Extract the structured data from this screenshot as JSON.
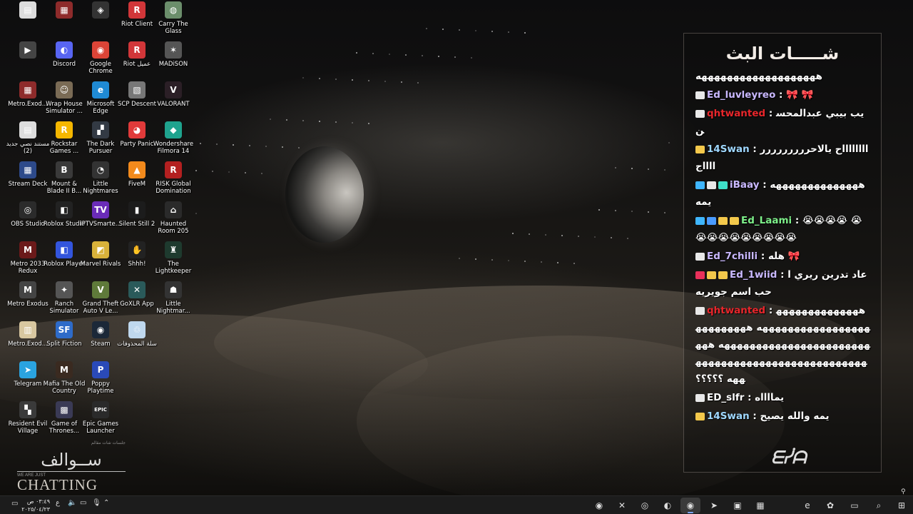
{
  "desktop": {
    "icons": [
      {
        "label": "",
        "color": "#dddddd",
        "glyph": "▤",
        "icon": "text-file-icon"
      },
      {
        "label": "",
        "color": "#8e2b2b",
        "glyph": "▦",
        "icon": "winrar-icon"
      },
      {
        "label": "",
        "color": "#333333",
        "glyph": "◈",
        "icon": "app-icon"
      },
      {
        "label": "Riot Client",
        "color": "#d13639",
        "glyph": "R",
        "icon": "riot-client-icon"
      },
      {
        "label": "Carry The Glass",
        "color": "#6b8e6b",
        "glyph": "◍",
        "icon": "carry-the-glass-icon"
      },
      {
        "label": "",
        "color": "#444444",
        "glyph": "▶",
        "icon": "youtube-icon"
      },
      {
        "label": "Discord",
        "color": "#5865f2",
        "glyph": "◐",
        "icon": "discord-icon"
      },
      {
        "label": "Google Chrome",
        "color": "#db4437",
        "glyph": "◉",
        "icon": "chrome-icon"
      },
      {
        "label": "Riot عميل",
        "color": "#d13639",
        "glyph": "R",
        "icon": "riot-client-icon"
      },
      {
        "label": "MADiSON",
        "color": "#555555",
        "glyph": "✶",
        "icon": "madison-icon"
      },
      {
        "label": "Metro.Exod...",
        "color": "#8e2b2b",
        "glyph": "▦",
        "icon": "winrar-icon"
      },
      {
        "label": "Wrap House Simulator ...",
        "color": "#7a6b55",
        "glyph": "☺",
        "icon": "wrap-house-icon"
      },
      {
        "label": "Microsoft Edge",
        "color": "#1f8ad4",
        "glyph": "e",
        "icon": "edge-icon"
      },
      {
        "label": "SCP Descent",
        "color": "#777777",
        "glyph": "▧",
        "icon": "scp-descent-icon"
      },
      {
        "label": "VALORANT",
        "color": "#2b1f26",
        "glyph": "V",
        "icon": "valorant-icon"
      },
      {
        "label": "مستند نصي جديد (2)",
        "color": "#dddddd",
        "glyph": "▤",
        "icon": "text-file-icon"
      },
      {
        "label": "Rockstar Games ...",
        "color": "#f5b700",
        "glyph": "R",
        "icon": "rockstar-icon"
      },
      {
        "label": "The Dark Pursuer",
        "color": "#333a44",
        "glyph": "▞",
        "icon": "dark-pursuer-icon"
      },
      {
        "label": "Party Panic",
        "color": "#e03a3a",
        "glyph": "◕",
        "icon": "party-panic-icon"
      },
      {
        "label": "Wondershare Filmora 14",
        "color": "#1fa38e",
        "glyph": "◆",
        "icon": "filmora-icon"
      },
      {
        "label": "Stream Deck",
        "color": "#2d4a8a",
        "glyph": "▦",
        "icon": "stream-deck-icon"
      },
      {
        "label": "Mount & Blade II B...",
        "color": "#3a3a3a",
        "glyph": "B",
        "icon": "bannerlord-icon"
      },
      {
        "label": "Little Nightmares",
        "color": "#333333",
        "glyph": "◔",
        "icon": "little-nightmares-icon"
      },
      {
        "label": "FiveM",
        "color": "#f28a1c",
        "glyph": "▲",
        "icon": "fivem-icon"
      },
      {
        "label": "RISK Global Domination",
        "color": "#b32020",
        "glyph": "R",
        "icon": "risk-icon"
      },
      {
        "label": "OBS Studio",
        "color": "#2b2b2b",
        "glyph": "◎",
        "icon": "obs-icon"
      },
      {
        "label": "Roblox Studio",
        "color": "#222222",
        "glyph": "◧",
        "icon": "roblox-studio-icon"
      },
      {
        "label": "IPTVSmarte...",
        "color": "#6a2bb8",
        "glyph": "TV",
        "icon": "iptv-icon"
      },
      {
        "label": "Silent Still 2",
        "color": "#1c1c1c",
        "glyph": "▮",
        "icon": "silent-still-icon"
      },
      {
        "label": "Haunted Room 205",
        "color": "#2a2a2a",
        "glyph": "⌂",
        "icon": "haunted-room-icon"
      },
      {
        "label": "Metro 2033 Redux",
        "color": "#6b1a1a",
        "glyph": "M",
        "icon": "metro-2033-icon"
      },
      {
        "label": "Roblox Player",
        "color": "#3355dd",
        "glyph": "◧",
        "icon": "roblox-icon"
      },
      {
        "label": "Marvel Rivals",
        "color": "#d9b23a",
        "glyph": "◩",
        "icon": "marvel-rivals-icon"
      },
      {
        "label": "Shhh!",
        "color": "#222222",
        "glyph": "✋",
        "icon": "shhh-icon"
      },
      {
        "label": "The Lightkeeper",
        "color": "#1e3a2e",
        "glyph": "♜",
        "icon": "lightkeeper-icon"
      },
      {
        "label": "Metro Exodus",
        "color": "#444444",
        "glyph": "M",
        "icon": "metro-exodus-icon"
      },
      {
        "label": "Ranch Simulator",
        "color": "#555555",
        "glyph": "✦",
        "icon": "ranch-simulator-icon"
      },
      {
        "label": "Grand Theft Auto V Le...",
        "color": "#5f7a3a",
        "glyph": "V",
        "icon": "gta-v-icon"
      },
      {
        "label": "GoXLR App",
        "color": "#2a5a5a",
        "glyph": "✕",
        "icon": "goxlr-icon"
      },
      {
        "label": "Little Nightmar...",
        "color": "#333333",
        "glyph": "☗",
        "icon": "little-nightmares-icon"
      },
      {
        "label": "Metro.Exod...",
        "color": "#d8c7a0",
        "glyph": "▥",
        "icon": "archive-icon"
      },
      {
        "label": "Split Fiction",
        "color": "#2e6bc9",
        "glyph": "SF",
        "icon": "split-fiction-icon"
      },
      {
        "label": "Steam",
        "color": "#1b2838",
        "glyph": "◉",
        "icon": "steam-icon"
      },
      {
        "label": "سلة المحذوفات",
        "color": "#bfd8ee",
        "glyph": "♲",
        "icon": "recycle-bin-icon"
      },
      {
        "label": "",
        "color": "#000000",
        "glyph": "",
        "icon": ""
      },
      {
        "label": "Telegram",
        "color": "#2aa3e0",
        "glyph": "➤",
        "icon": "telegram-icon"
      },
      {
        "label": "Mafia The Old Country",
        "color": "#3a2a20",
        "glyph": "M",
        "icon": "mafia-icon"
      },
      {
        "label": "Poppy Playtime",
        "color": "#2a4ab8",
        "glyph": "P",
        "icon": "poppy-playtime-icon"
      },
      {
        "label": "",
        "color": "#000000",
        "glyph": "",
        "icon": ""
      },
      {
        "label": "",
        "color": "#000000",
        "glyph": "",
        "icon": ""
      },
      {
        "label": "Resident Evil Village",
        "color": "#3a3a3a",
        "glyph": "▚",
        "icon": "resident-evil-icon"
      },
      {
        "label": "Game of Thrones...",
        "color": "#3a3a55",
        "glyph": "▩",
        "icon": "game-of-thrones-icon"
      },
      {
        "label": "Epic Games Launcher",
        "color": "#2a2a2a",
        "glyph": "EPIC",
        "icon": "epic-games-icon"
      }
    ]
  },
  "brand": {
    "arabic": "ســوالف",
    "sub": "جلسات شات مقالم",
    "small": "WE ARE JUST",
    "chatting": "CHATTING"
  },
  "chat": {
    "title": "شـــــات البث",
    "messages": [
      {
        "badges": [],
        "user": "",
        "user_color": "#ffffff",
        "text": "هههههههههههههههههههه"
      },
      {
        "badges": [
          "#e8e8e8"
        ],
        "user": "Ed_luvleyreo",
        "user_color": "#c9b8ff",
        "text": " : 🎀 🎀"
      },
      {
        "badges": [
          "#e8e8e8"
        ],
        "user": "qhtwanted",
        "user_color": "#e8262b",
        "text": " : يب بيبي عبدالمحسن"
      },
      {
        "badges": [
          "#f3c84b"
        ],
        "user": "14Swan",
        "user_color": "#9fd8ff",
        "text": " : ااااااااح يالاحرررررررررااااج"
      },
      {
        "badges": [
          "#3fb6ff",
          "#e8e8e8",
          "#3fe0c8"
        ],
        "user": "iBaay",
        "user_color": "#c9b8ff",
        "text": " : ههههههههههههههه يمه"
      },
      {
        "badges": [
          "#3fb6ff",
          "#4a9bff",
          "#f3c84b",
          "#f3c84b"
        ],
        "user": "Ed_Laami",
        "user_color": "#7ef08a",
        "text": " : 😭😭😭😭 😭😭😭😭😭😭😭😭😭😭"
      },
      {
        "badges": [
          "#e8e8e8"
        ],
        "user": "Ed_7chilli",
        "user_color": "#c9b8ff",
        "text": " : هله 🎀"
      },
      {
        "badges": [
          "#e8305a",
          "#f3c84b",
          "#f3c84b"
        ],
        "user": "Ed_1wiid",
        "user_color": "#c9b8ff",
        "text": " : عاد تدرين ريري احب اسم جويريه"
      },
      {
        "badges": [
          "#e8e8e8"
        ],
        "user": "qhtwanted",
        "user_color": "#e8262b",
        "text": " : هههههههههههههههههههههههههههههههه ههههههههههههههههههههههههههههههههه ههههههههههههههههههههههههههههههههه ؟؟؟؟؟"
      },
      {
        "badges": [
          "#e8e8e8"
        ],
        "user": "ED_slfr",
        "user_color": "#ffffff",
        "text": " : يمااااه"
      },
      {
        "badges": [
          "#f3c84b"
        ],
        "user": "14Swan",
        "user_color": "#9fd8ff",
        "text": " : يمه والله يصيح"
      }
    ],
    "logo": "ᗴᓰᗩ"
  },
  "taskbar": {
    "clock_time": "٠٣:٤٩ ص",
    "clock_date": "٢٠٢٥/٠٤/٢٣",
    "lang": "ع",
    "apps": [
      {
        "glyph": "◉",
        "icon": "steam-taskbar-icon"
      },
      {
        "glyph": "✕",
        "icon": "goxlr-taskbar-icon"
      },
      {
        "glyph": "◎",
        "icon": "obs-taskbar-icon"
      },
      {
        "glyph": "◐",
        "icon": "discord-taskbar-icon"
      },
      {
        "glyph": "◉",
        "icon": "chrome-taskbar-icon"
      },
      {
        "glyph": "➤",
        "icon": "telegram-taskbar-icon"
      },
      {
        "glyph": "▣",
        "icon": "outlook-taskbar-icon"
      },
      {
        "glyph": "▦",
        "icon": "store-taskbar-icon"
      },
      {
        "glyph": "e",
        "icon": "edge-taskbar-icon"
      },
      {
        "glyph": "✿",
        "icon": "copilot-taskbar-icon"
      },
      {
        "glyph": "▭",
        "icon": "task-view-icon"
      },
      {
        "glyph": "⌕",
        "icon": "search-icon"
      },
      {
        "glyph": "⊞",
        "icon": "windows-start-icon"
      }
    ]
  }
}
